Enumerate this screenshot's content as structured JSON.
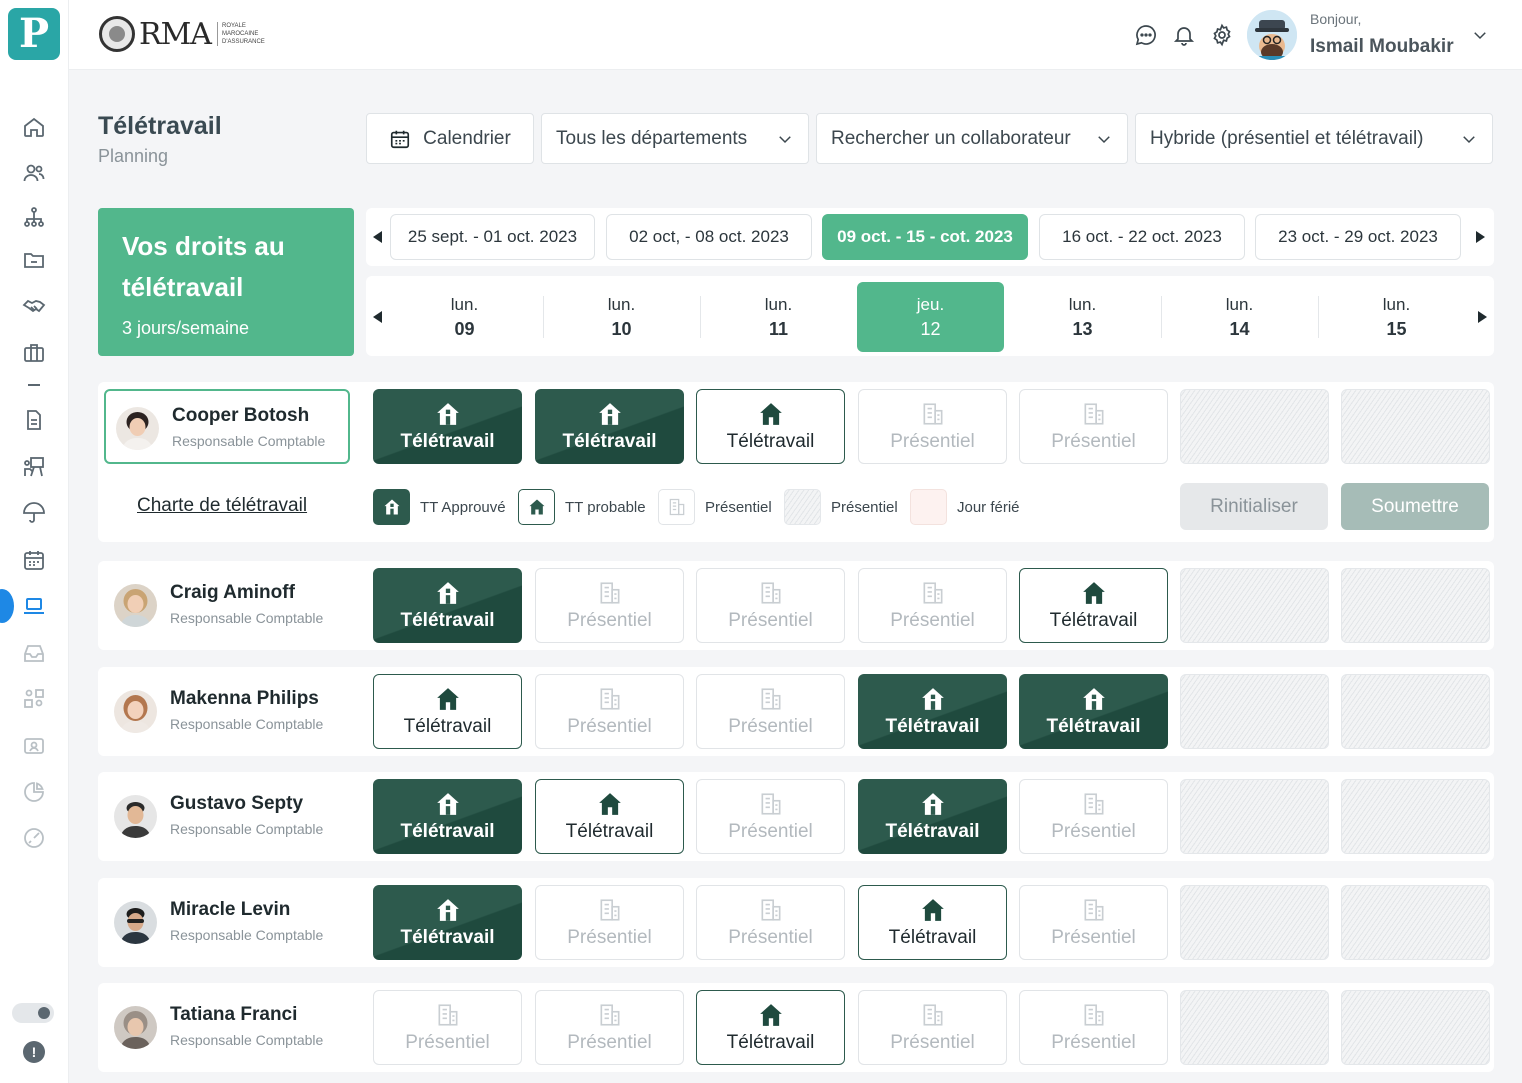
{
  "app": {
    "brand_name": "RMA",
    "brand_sub": "ROYALE MAROCAINE D'ASSURANCE",
    "logo_letter": "P"
  },
  "user": {
    "greeting": "Bonjour,",
    "name": "Ismail Moubakir"
  },
  "page": {
    "title": "Télétravail",
    "subtitle": "Planning"
  },
  "filters": {
    "calendar": "Calendrier",
    "departments": "Tous les départements",
    "search": "Rechercher un collaborateur",
    "mode": "Hybride (présentiel et télétravail)"
  },
  "rights": {
    "title_line1": "Vos droits au",
    "title_line2": "télétravail",
    "quota": "3 jours/semaine"
  },
  "weeks": [
    "25 sept. - 01 oct. 2023",
    "02 oct, - 08 oct. 2023",
    "09 oct. - 15 - cot. 2023",
    "16 oct. - 22 oct. 2023",
    "23 oct. - 29 oct. 2023"
  ],
  "days": [
    {
      "name": "lun.",
      "num": "09"
    },
    {
      "name": "lun.",
      "num": "10"
    },
    {
      "name": "lun.",
      "num": "11"
    },
    {
      "name": "jeu.",
      "num": "12"
    },
    {
      "name": "lun.",
      "num": "13"
    },
    {
      "name": "lun.",
      "num": "14"
    },
    {
      "name": "lun.",
      "num": "15"
    }
  ],
  "labels": {
    "teletravail": "Télétravail",
    "presentiel": "Présentiel"
  },
  "legend": {
    "charter": "Charte de télétravail",
    "approved": "TT Approuvé",
    "probable": "TT probable",
    "presentiel": "Présentiel",
    "presentiel2": "Présentiel",
    "holiday": "Jour férié"
  },
  "actions": {
    "reset": "Rinitialiser",
    "submit": "Soumettre"
  },
  "employees": [
    {
      "name": "Cooper Botosh",
      "role": "Responsable Comptable"
    },
    {
      "name": "Craig Aminoff",
      "role": "Responsable Comptable"
    },
    {
      "name": "Makenna Philips",
      "role": "Responsable Comptable"
    },
    {
      "name": "Gustavo Septy",
      "role": "Responsable Comptable"
    },
    {
      "name": "Miracle Levin",
      "role": "Responsable Comptable"
    },
    {
      "name": "Tatiana Franci",
      "role": "Responsable Comptable"
    }
  ],
  "colors": {
    "accent": "#52b78c",
    "approved": "#2d5a4d",
    "active_nav": "#1e88e5"
  },
  "icons": {
    "approved": "house-check-icon",
    "probable": "house-icon",
    "presentiel": "building-icon"
  }
}
